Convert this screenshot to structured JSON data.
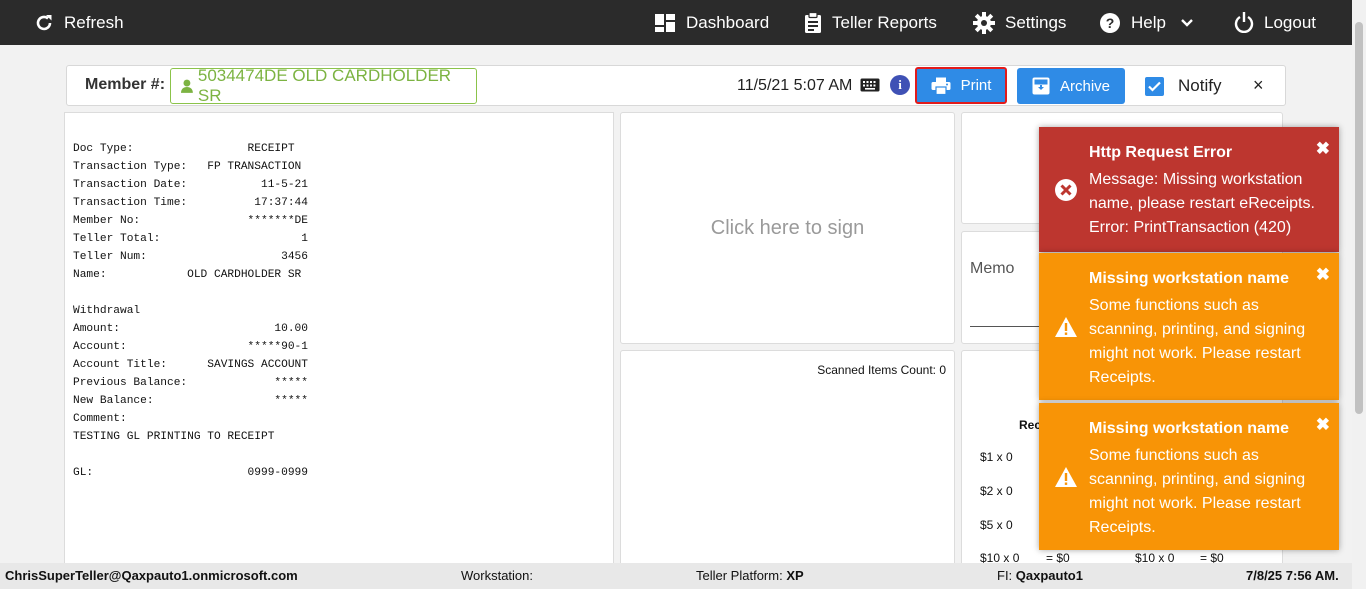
{
  "nav": {
    "refresh": "Refresh",
    "dashboard": "Dashboard",
    "teller_reports": "Teller Reports",
    "settings": "Settings",
    "help": "Help",
    "logout": "Logout"
  },
  "header": {
    "member_label": "Member #:",
    "member_value": "5034474DE OLD CARDHOLDER SR",
    "datetime": "11/5/21 5:07 AM",
    "info": "i",
    "print": "Print",
    "archive": "Archive",
    "notify": "Notify",
    "close": "×"
  },
  "receipt": {
    "text": "Doc Type:                 RECEIPT\nTransaction Type:   FP TRANSACTION\nTransaction Date:           11-5-21\nTransaction Time:          17:37:44\nMember No:                *******DE\nTeller Total:                     1\nTeller Num:                    3456\nName:            OLD CARDHOLDER SR\n\nWithdrawal\nAmount:                       10.00\nAccount:                  *****90-1\nAccount Title:      SAVINGS ACCOUNT\nPrevious Balance:             *****\nNew Balance:                  *****\nComment:\nTESTING GL PRINTING TO RECEIPT\n\nGL:                       0999-0999"
  },
  "sign": {
    "placeholder": "Click here to sign"
  },
  "scan": {
    "label": "Scanned Items Count: 0"
  },
  "memo": {
    "label": "Memo"
  },
  "cash": {
    "title": "Rec",
    "rows": [
      "$1 x 0",
      "$2 x 0",
      "$5 x 0",
      "$10 x 0"
    ],
    "row_10_total": "= $0",
    "row_10_right": "$10 x 0",
    "row_10_right_total": "= $0"
  },
  "toasts": [
    {
      "type": "error",
      "title": "Http Request Error",
      "message": "Message: Missing workstation name, please restart eReceipts. Error: PrintTransaction (420)",
      "close": "✖"
    },
    {
      "type": "warning",
      "title": "Missing workstation name",
      "message": "Some functions such as scanning, printing, and signing might not work. Please restart Receipts.",
      "close": "✖"
    },
    {
      "type": "warning",
      "title": "Missing workstation name",
      "message": "Some functions such as scanning, printing, and signing might not work. Please restart Receipts.",
      "close": "✖"
    }
  ],
  "status": {
    "user": "ChrisSuperTeller@Qaxpauto1.onmicrosoft.com",
    "workstation_label": "Workstation:",
    "platform_label": "Teller Platform:",
    "platform_value": "XP",
    "fi_label": "FI:",
    "fi_value": "Qaxpauto1",
    "datetime": "7/8/25 7:56 AM."
  },
  "colors": {
    "nav_bg": "#2b2b2b",
    "primary": "#2f8be6",
    "member_green": "#7cb342",
    "error": "#bd362f",
    "warning": "#f89406",
    "print_outline": "#e21b1b"
  }
}
